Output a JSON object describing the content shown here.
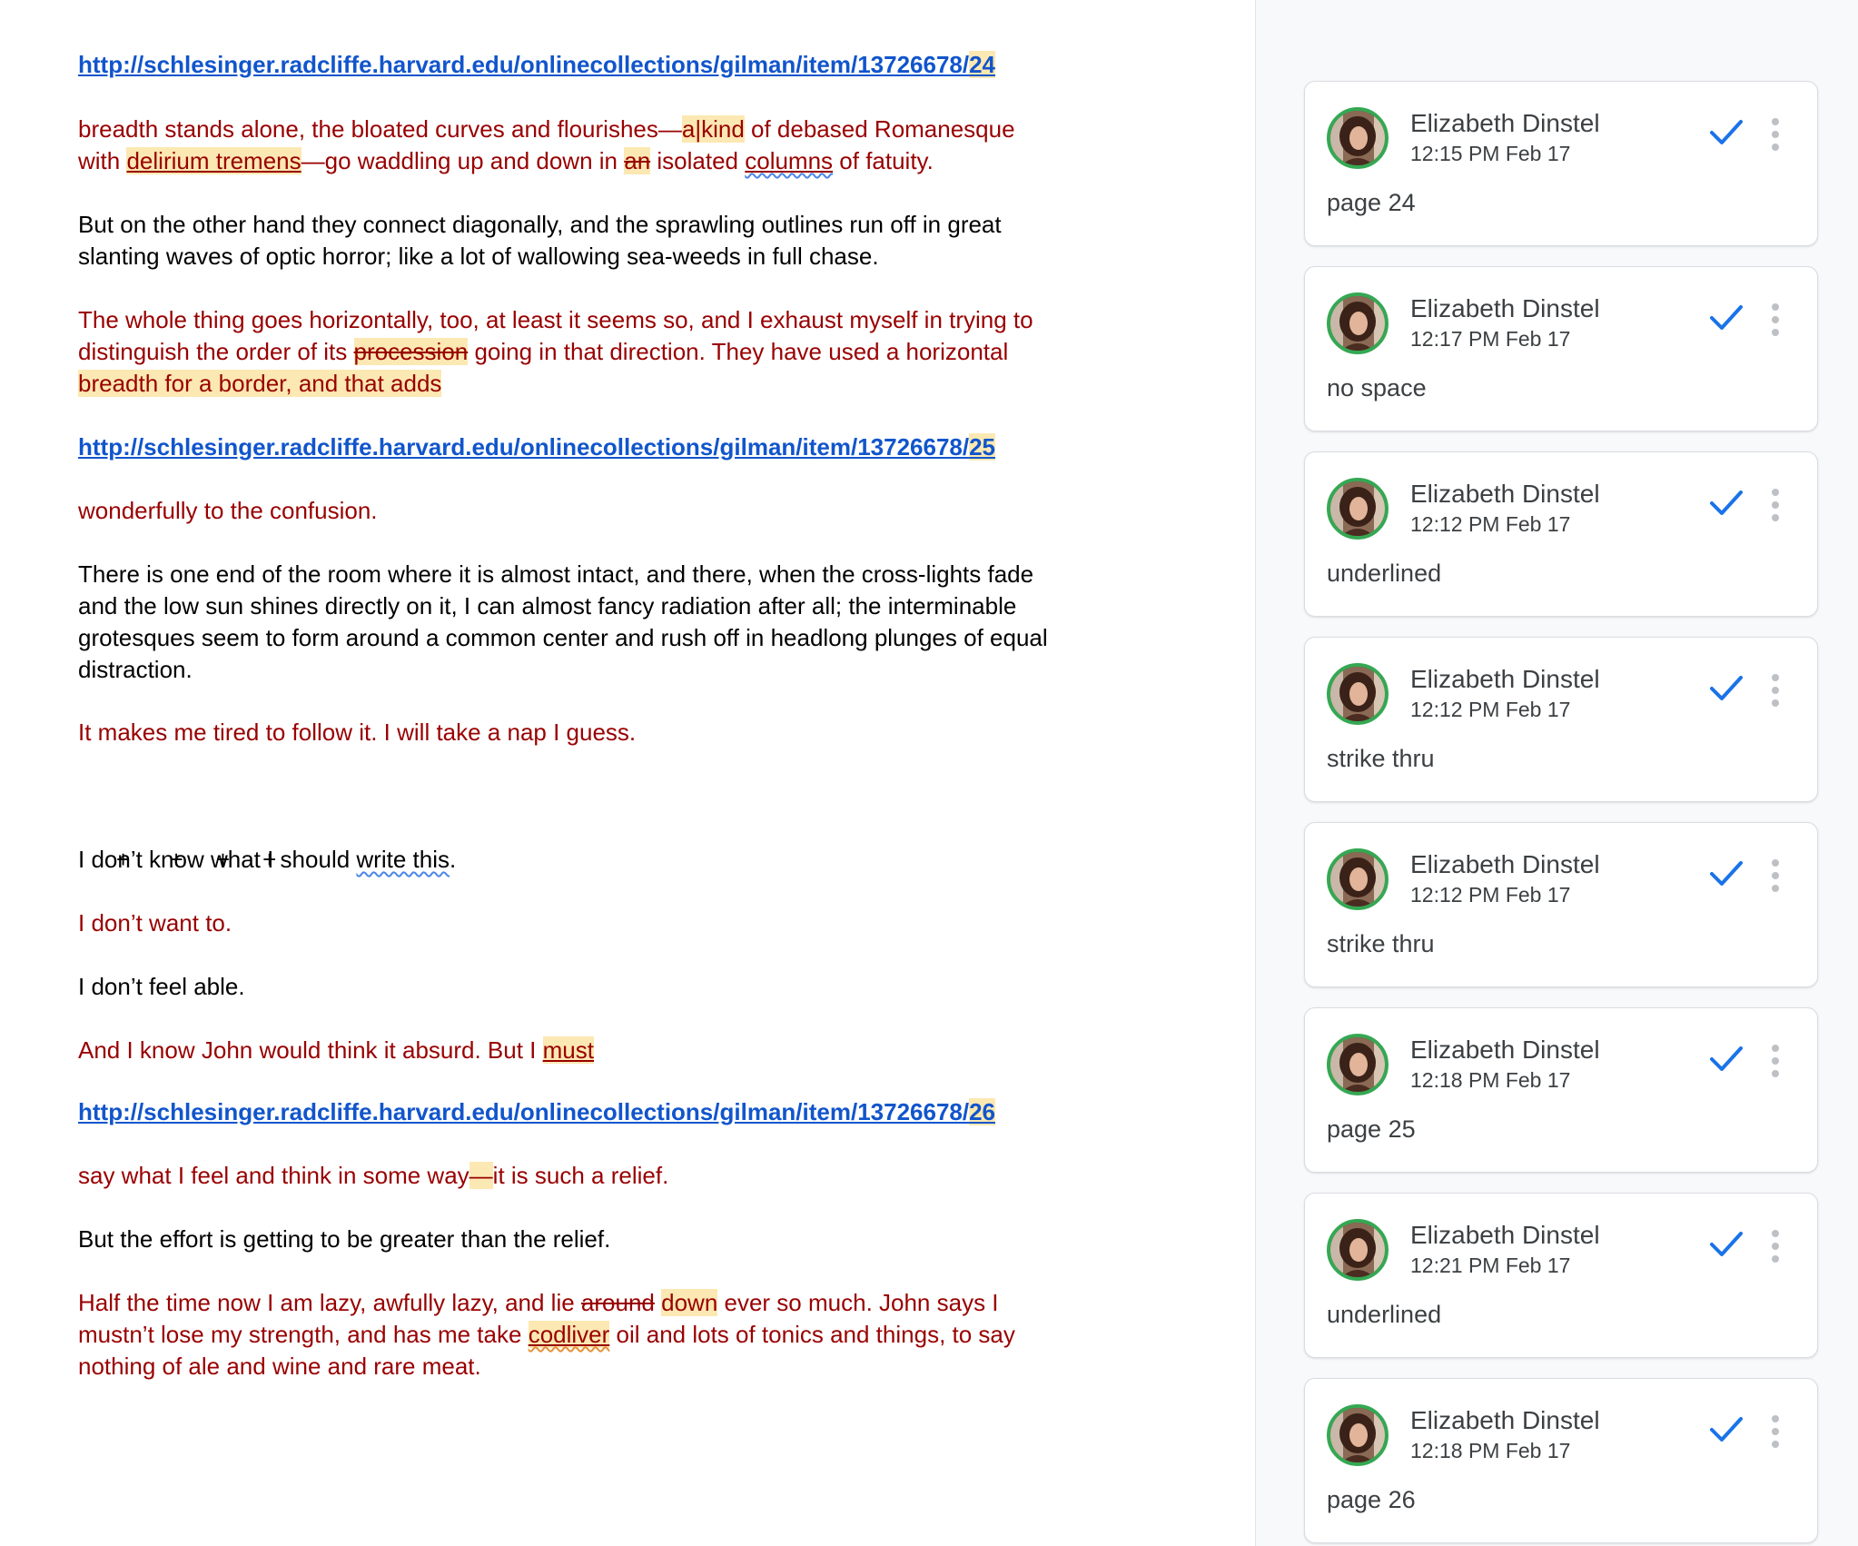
{
  "document": {
    "p1": {
      "link_prefix": "http://schlesinger.radcliffe.harvard.edu/onlinecollections/gilman/item/13726678/",
      "link_page": "24"
    },
    "p2": {
      "l1_a": "breadth stands alone, the bloated curves and flourishes—",
      "l1_hl": "a|kind",
      "l1_b": " of debased Romanesque",
      "l2_a": "with ",
      "l2_ul": "delirium tremens",
      "l2_b": "—go waddling up and down in ",
      "l2_st": "an",
      "l2_c": " isolated ",
      "l2_sq": "columns",
      "l2_d": " of fatuity."
    },
    "p3": {
      "l1": "But on the other hand they connect diagonally, and the sprawling outlines run off in great",
      "l2": "slanting waves of optic horror; like a lot of wallowing sea-weeds in full chase."
    },
    "p4": {
      "l1": "The whole thing goes horizontally, too, at least it seems so, and I exhaust myself in trying to",
      "l2_a": "distinguish the order of its ",
      "l2_st": "procession",
      "l2_b": " going in that direction. They have used a horizontal",
      "l3": "breadth for a border, and that adds"
    },
    "p5": {
      "link_prefix": "http://schlesinger.radcliffe.harvard.edu/onlinecollections/gilman/item/13726678/",
      "link_page": "25"
    },
    "p6": {
      "l1": "wonderfully to the confusion."
    },
    "p7": {
      "l1": "There is one end of the room where it is almost intact, and there, when the cross-lights fade",
      "l2": "and the low sun shines directly on it, I can almost fancy radiation after all; the interminable",
      "l3": "grotesques seem to form around a common center and rush off in headlong plunges of equal",
      "l4": "distraction."
    },
    "p8": {
      "l1": "It makes me tired to follow it. I will take a nap I guess."
    },
    "p9": {
      "l1": "+      +     +     +"
    },
    "p10": {
      "l1_a": "I don’t know what I should ",
      "l1_sq": "write this",
      "l1_b": "."
    },
    "p11": {
      "l1": "I don’t want to."
    },
    "p12": {
      "l1": "I don’t feel able."
    },
    "p13": {
      "l1_a": "And I know John would think it absurd. But I ",
      "l1_ul": "must"
    },
    "p14": {
      "link_prefix": "http://schlesinger.radcliffe.harvard.edu/onlinecollections/gilman/item/13726678/",
      "link_page": "26"
    },
    "p15": {
      "l1_a": "say what I feel and think in some way",
      "l1_hl": "—",
      "l1_b": "it is such a relief."
    },
    "p16": {
      "l1": "But the effort is getting to be greater than the relief."
    },
    "p17": {
      "l1_a": "Half the time now I am lazy, awfully lazy, and lie ",
      "l1_st": "around",
      "l1_b": " ",
      "l1_hl": "down",
      "l1_c": " ever so much. John says I",
      "l2_a": "mustn’t lose my strength, and has me take ",
      "l2_sq": "codliver",
      "l2_b": " oil and lots of tonics and things, to say",
      "l3": "nothing of ale and wine and rare meat."
    }
  },
  "comments": [
    {
      "author": "Elizabeth Dinstel",
      "time": "12:15 PM Feb 17",
      "body": "page 24"
    },
    {
      "author": "Elizabeth Dinstel",
      "time": "12:17 PM Feb 17",
      "body": "no space"
    },
    {
      "author": "Elizabeth Dinstel",
      "time": "12:12 PM Feb 17",
      "body": "underlined"
    },
    {
      "author": "Elizabeth Dinstel",
      "time": "12:12 PM Feb 17",
      "body": "strike thru"
    },
    {
      "author": "Elizabeth Dinstel",
      "time": "12:12 PM Feb 17",
      "body": "strike thru"
    },
    {
      "author": "Elizabeth Dinstel",
      "time": "12:18 PM Feb 17",
      "body": "page 25"
    },
    {
      "author": "Elizabeth Dinstel",
      "time": "12:21 PM Feb 17",
      "body": "underlined"
    },
    {
      "author": "Elizabeth Dinstel",
      "time": "12:18 PM Feb 17",
      "body": "page 26"
    }
  ],
  "icons": {
    "resolve": "checkmark-icon",
    "more": "more-vert-icon",
    "avatar": "user-avatar"
  },
  "colors": {
    "link": "#1155cc",
    "edited_text": "#990000",
    "highlight": "#fce8b2",
    "resolve_check": "#1a73e8",
    "avatar_ring": "#34a853",
    "panel_bg": "#f8f9fa"
  }
}
